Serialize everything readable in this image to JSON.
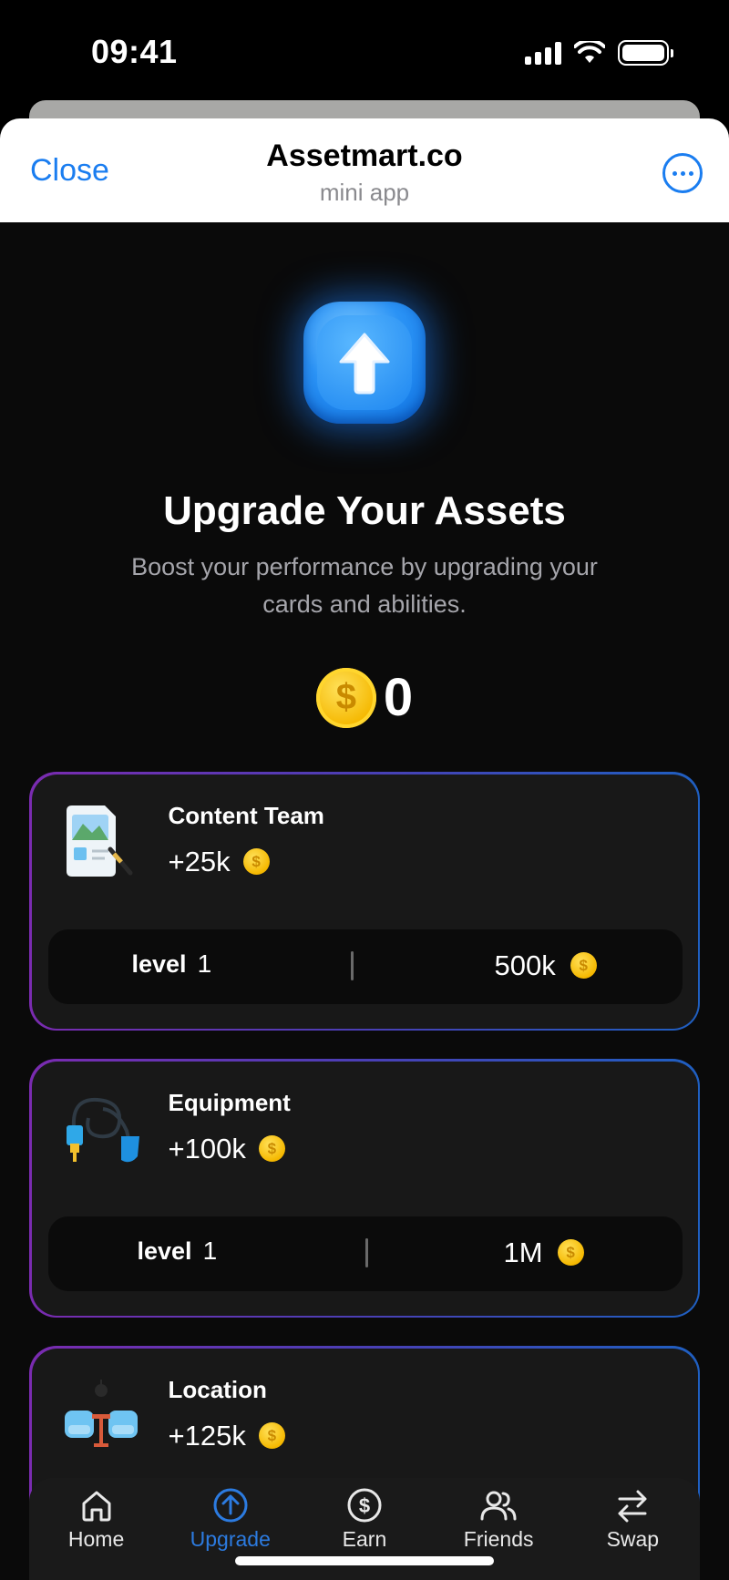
{
  "status_bar": {
    "time": "09:41"
  },
  "header": {
    "close_label": "Close",
    "title": "Assetmart.co",
    "subtitle": "mini app"
  },
  "hero": {
    "title": "Upgrade Your Assets",
    "description": "Boost your performance by upgrading your cards and abilities.",
    "balance": "0"
  },
  "cards": [
    {
      "title": "Content Team",
      "profit": "+25k",
      "level_label": "level",
      "level": "1",
      "price": "500k",
      "icon": "content-team-icon"
    },
    {
      "title": "Equipment",
      "profit": "+100k",
      "level_label": "level",
      "level": "1",
      "price": "1M",
      "icon": "equipment-icon"
    },
    {
      "title": "Location",
      "profit": "+125k",
      "icon": "location-icon"
    }
  ],
  "nav": [
    {
      "label": "Home",
      "icon": "home-icon"
    },
    {
      "label": "Upgrade",
      "icon": "upgrade-icon",
      "active": true
    },
    {
      "label": "Earn",
      "icon": "dollar-icon"
    },
    {
      "label": "Friends",
      "icon": "friends-icon"
    },
    {
      "label": "Swap",
      "icon": "swap-icon"
    }
  ],
  "colors": {
    "accent": "#1a7df0",
    "active_nav": "#2c7be0",
    "coin": "#f5b800"
  }
}
